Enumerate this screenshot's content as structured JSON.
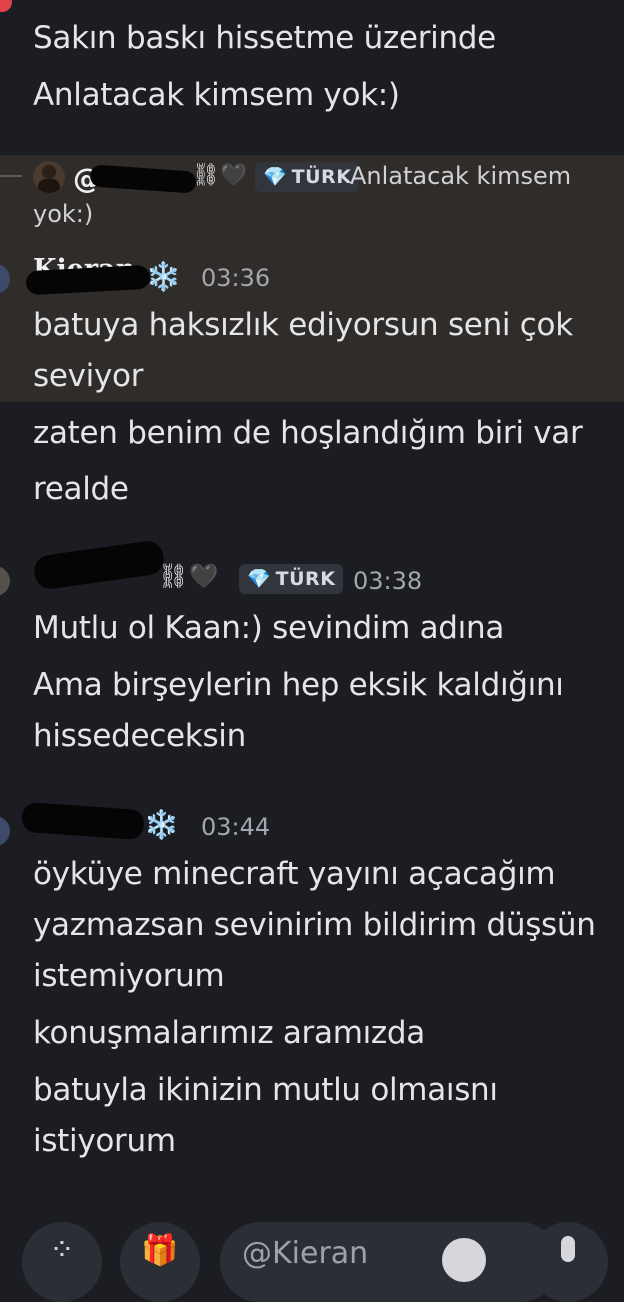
{
  "prev_lines": [
    "Sakın baskı hissetme üzerinde",
    "Anlatacak kimsem yok:)"
  ],
  "reply": {
    "name_tail": "⛓🖤",
    "badge": "TÜRK",
    "text_line1": "Anlatacak kimsem",
    "text_line2": "yok:)"
  },
  "messages": [
    {
      "author": "Kieran",
      "suffix": "❄️",
      "time": "03:36",
      "lines": [
        "batuya haksızlık ediyorsun seni çok",
        "seviyor",
        "zaten benim de hoşlandığım biri var",
        "realde"
      ]
    },
    {
      "author_tail": "⛓🖤",
      "badge": "TÜRK",
      "time": "03:38",
      "lines": [
        "Mutlu ol Kaan:) sevindim adına",
        "Ama birşeylerin hep eksik kaldığını",
        "hissedeceksin"
      ]
    },
    {
      "suffix": "❄️",
      "time": "03:44",
      "lines": [
        "öyküye minecraft yayını açacağım",
        "yazmazsan sevinirim bildirim düşsün",
        "istemiyorum",
        "konuşmalarımız aramızda",
        "batuyla ikinizin mutlu olmaısnı",
        "istiyorum"
      ]
    }
  ],
  "composer": {
    "placeholder": "@Kieran",
    "icons": [
      "apps-icon",
      "gift-icon",
      "emoji-icon",
      "mic-icon"
    ]
  },
  "colors": {
    "background": "#1c1d23",
    "highlight": "#2f2c29",
    "badge_gem": "#e34ae8"
  }
}
